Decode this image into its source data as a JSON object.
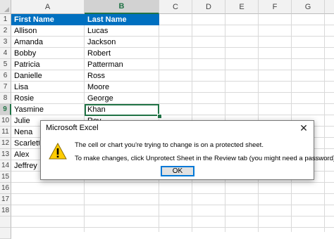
{
  "spreadsheet": {
    "columns": [
      "A",
      "B",
      "C",
      "D",
      "E",
      "F",
      "G"
    ],
    "selected_column": "B",
    "rows": [
      "1",
      "2",
      "3",
      "4",
      "5",
      "6",
      "7",
      "8",
      "9",
      "10",
      "11",
      "12",
      "13",
      "14",
      "15",
      "16",
      "17",
      "18"
    ],
    "selected_row": "9",
    "header_cells": {
      "first": "First Name",
      "last": "Last Name"
    },
    "header_fill_color": "#0070c0",
    "accent_color": "#217346",
    "data": [
      {
        "first": "Allison",
        "last": "Lucas"
      },
      {
        "first": "Amanda",
        "last": "Jackson"
      },
      {
        "first": "Bobby",
        "last": "Robert"
      },
      {
        "first": "Patricia",
        "last": "Patterman"
      },
      {
        "first": "Danielle",
        "last": "Ross"
      },
      {
        "first": "Lisa",
        "last": "Moore"
      },
      {
        "first": "Rosie",
        "last": "George"
      },
      {
        "first": "Yasmine",
        "last": "Khan"
      },
      {
        "first": "Julie",
        "last": "Roy"
      },
      {
        "first": "Nena",
        "last": ""
      },
      {
        "first": "Scarlett",
        "last": ""
      },
      {
        "first": "Alex",
        "last": ""
      },
      {
        "first": "Jeffrey",
        "last": ""
      }
    ]
  },
  "dialog": {
    "title": "Microsoft Excel",
    "icon": "warning-icon",
    "message_line1": "The cell or chart you're trying to change is on a protected sheet.",
    "message_line2": "To make changes, click Unprotect Sheet in the Review tab (you might need a password).",
    "ok_label": "OK",
    "close_glyph": "✕",
    "focus_color": "#0078d7"
  }
}
